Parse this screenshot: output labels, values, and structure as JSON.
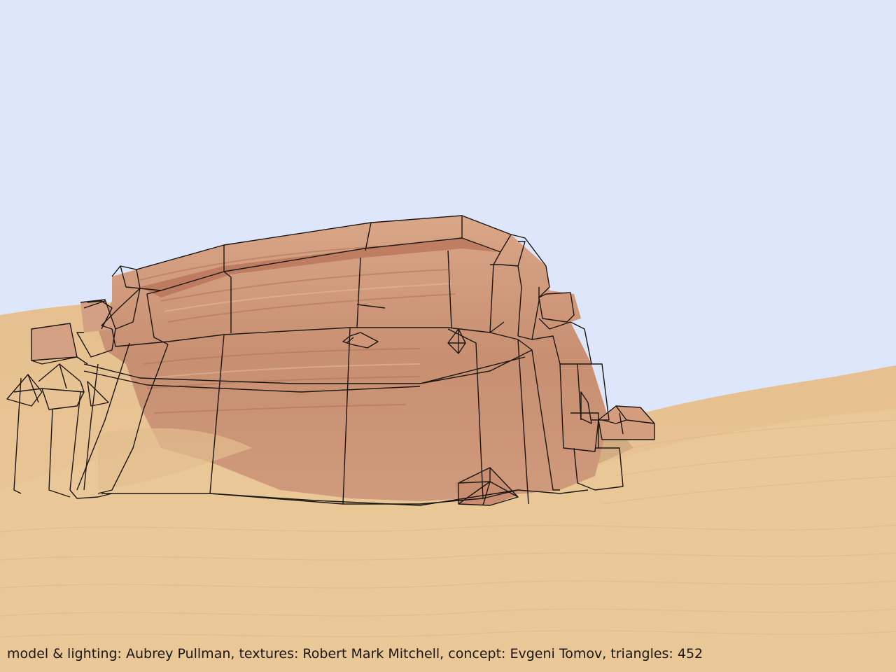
{
  "caption": "model & lighting: Aubrey Pullman, textures: Robert Mark Mitchell, concept: Evgeni Tomov, triangles: 452",
  "colors": {
    "sky": "#dde6fb",
    "sand": "#e8c596",
    "sand_shadow": "#d7ad7c",
    "rock_light": "#d7a384",
    "rock_mid": "#c78f70",
    "rock_band": "#b7795e",
    "wire": "#1a1612"
  }
}
